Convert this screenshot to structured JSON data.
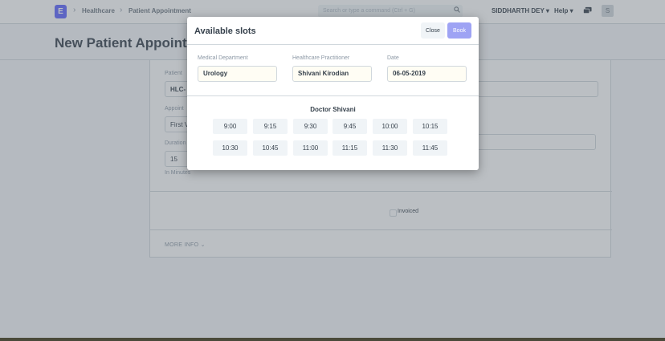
{
  "navbar": {
    "logo_letter": "E",
    "breadcrumbs": [
      "Healthcare",
      "Patient Appointment"
    ],
    "search_placeholder": "Search or type a command (Ctrl + G)",
    "user": "SIDDHARTH DEY",
    "help": "Help",
    "avatar": "S"
  },
  "page": {
    "title": "New Patient Appointment"
  },
  "form": {
    "patient_label": "Patient",
    "patient_value": "HLC-",
    "appointment_type_label": "Appoint",
    "appointment_type_value": "First V",
    "duration_label": "Duration",
    "duration_value": "15",
    "duration_help": "In Minutes",
    "invoiced_label": "Invoiced",
    "more_info": "MORE INFO"
  },
  "modal": {
    "title": "Available slots",
    "close_label": "Close",
    "book_label": "Book",
    "department_label": "Medical Department",
    "department_value": "Urology",
    "practitioner_label": "Healthcare Practitioner",
    "practitioner_value": "Shivani Kirodian",
    "date_label": "Date",
    "date_value": "06-05-2019",
    "doctor_heading": "Doctor Shivani",
    "slots": [
      "9:00",
      "9:15",
      "9:30",
      "9:45",
      "10:00",
      "10:15",
      "10:30",
      "10:45",
      "11:00",
      "11:15",
      "11:30",
      "11:45"
    ]
  },
  "colors": {
    "accent": "#5e64ff",
    "book_button": "#9ea3f4",
    "overlay": "#5c6670"
  },
  "icons": [
    "search-icon",
    "chevron-down-icon",
    "chat-icon"
  ]
}
